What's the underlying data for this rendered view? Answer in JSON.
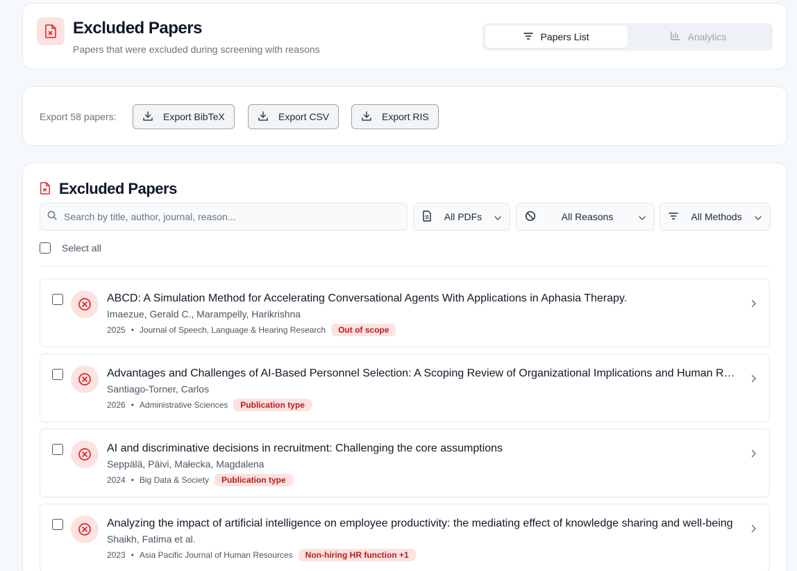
{
  "header": {
    "title": "Excluded Papers",
    "subtitle": "Papers that were excluded during screening with reasons",
    "tabs": [
      {
        "label": "Papers List",
        "icon": "filter-lines-icon",
        "active": true
      },
      {
        "label": "Analytics",
        "icon": "bar-chart-icon",
        "active": false
      }
    ]
  },
  "export": {
    "label": "Export 58 papers:",
    "buttons": [
      "Export BibTeX",
      "Export CSV",
      "Export RIS"
    ]
  },
  "list": {
    "title": "Excluded Papers",
    "search_placeholder": "Search by title, author, journal, reason...",
    "filters": {
      "pdfs": "All PDFs",
      "reasons": "All Reasons",
      "methods": "All Methods"
    },
    "select_all": "Select all",
    "papers": [
      {
        "title": "ABCD: A Simulation Method for Accelerating Conversational Agents With Applications in Aphasia Therapy.",
        "authors": "Imaezue, Gerald C., Marampelly, Harikrishna",
        "year": "2025",
        "journal": "Journal of Speech, Language & Hearing Research",
        "reason": "Out of scope"
      },
      {
        "title": "Advantages and Challenges of AI-Based Personnel Selection: A Scoping Review of Organizational Implications and Human Resource Management",
        "authors": "Santiago-Torner, Carlos",
        "year": "2026",
        "journal": "Administrative Sciences",
        "reason": "Publication type"
      },
      {
        "title": "AI and discriminative decisions in recruitment: Challenging the core assumptions",
        "authors": "Seppälä, Päivi, Małecka, Magdalena",
        "year": "2024",
        "journal": "Big Data & Society",
        "reason": "Publication type"
      },
      {
        "title": "Analyzing the impact of artificial intelligence on employee productivity: the mediating effect of knowledge sharing and well-being",
        "authors": "Shaikh, Fatima et al.",
        "year": "2023",
        "journal": "Asia Pacific Journal of Human Resources",
        "reason": "Non-hiring HR function +1"
      }
    ]
  },
  "colors": {
    "accent_red": "#dc2626",
    "pill_bg": "#fde2e2",
    "pill_text": "#b91c1c"
  }
}
